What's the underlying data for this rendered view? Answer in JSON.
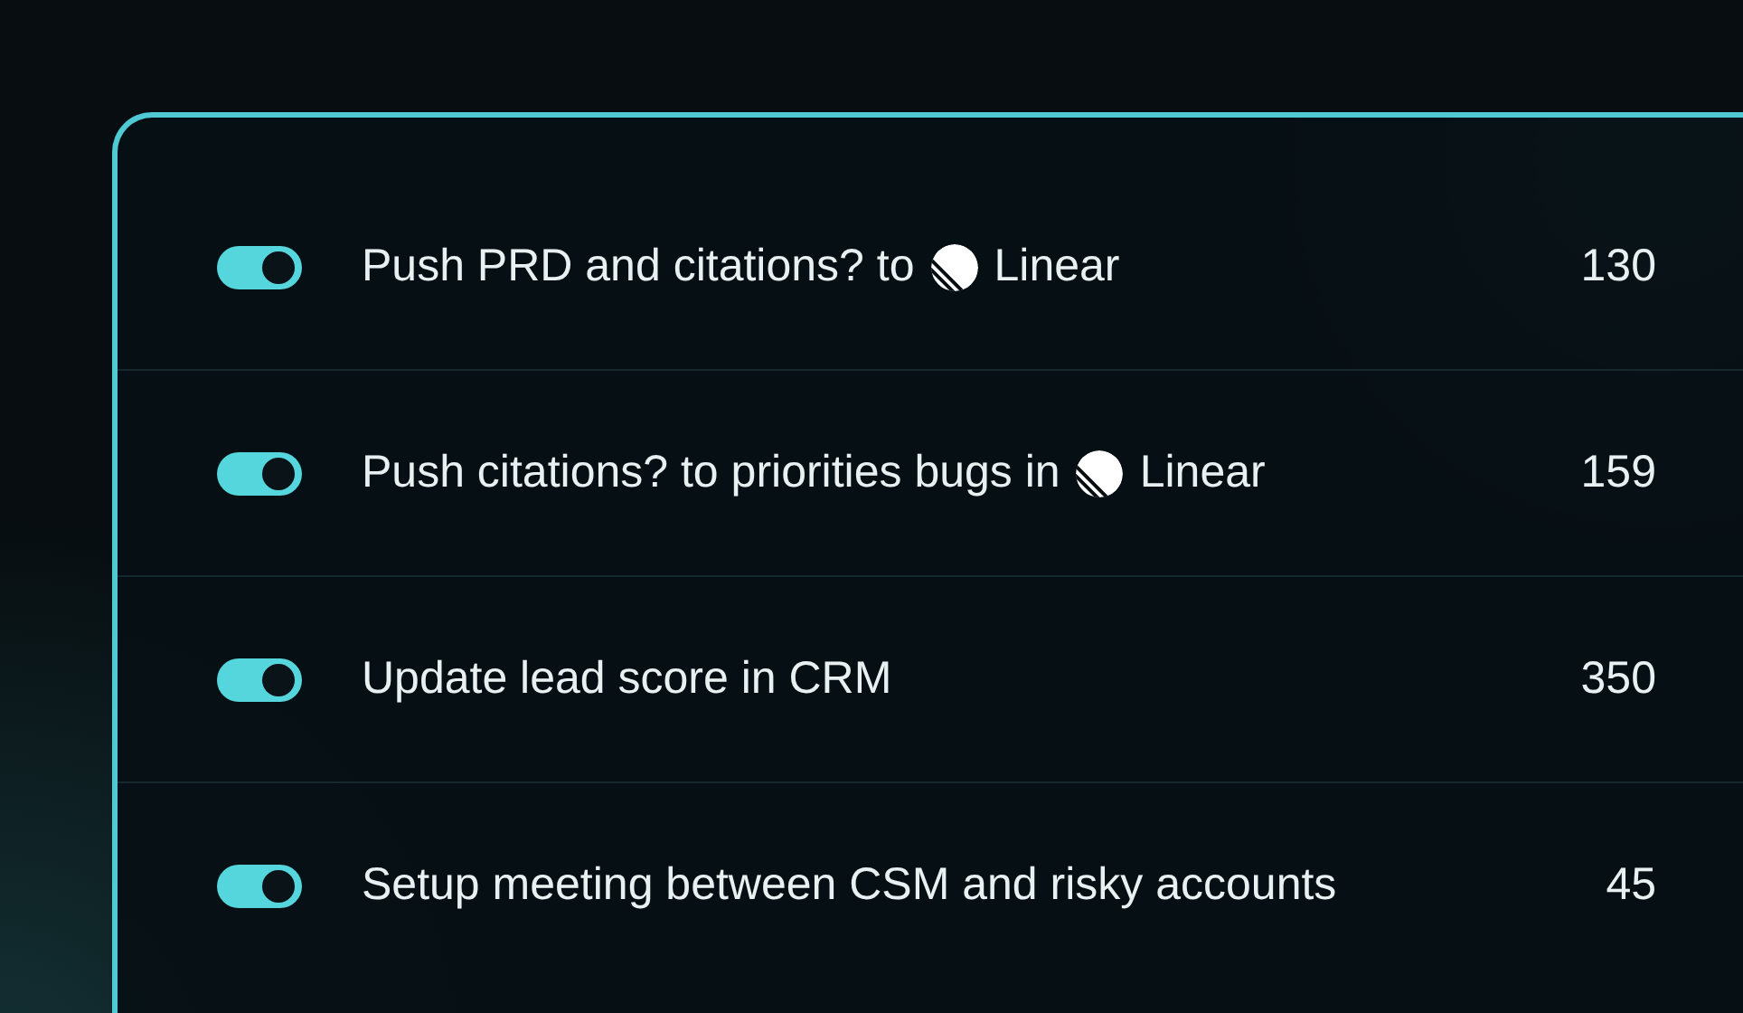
{
  "rows": [
    {
      "on": true,
      "label": "Push PRD and citations? to",
      "app": "Linear",
      "count": "130"
    },
    {
      "on": true,
      "label": "Push citations? to priorities bugs in",
      "app": "Linear",
      "count": "159"
    },
    {
      "on": true,
      "label": "Update lead score in CRM",
      "count": "350"
    },
    {
      "on": true,
      "label": "Setup meeting between CSM and risky accounts",
      "count": "45"
    }
  ]
}
